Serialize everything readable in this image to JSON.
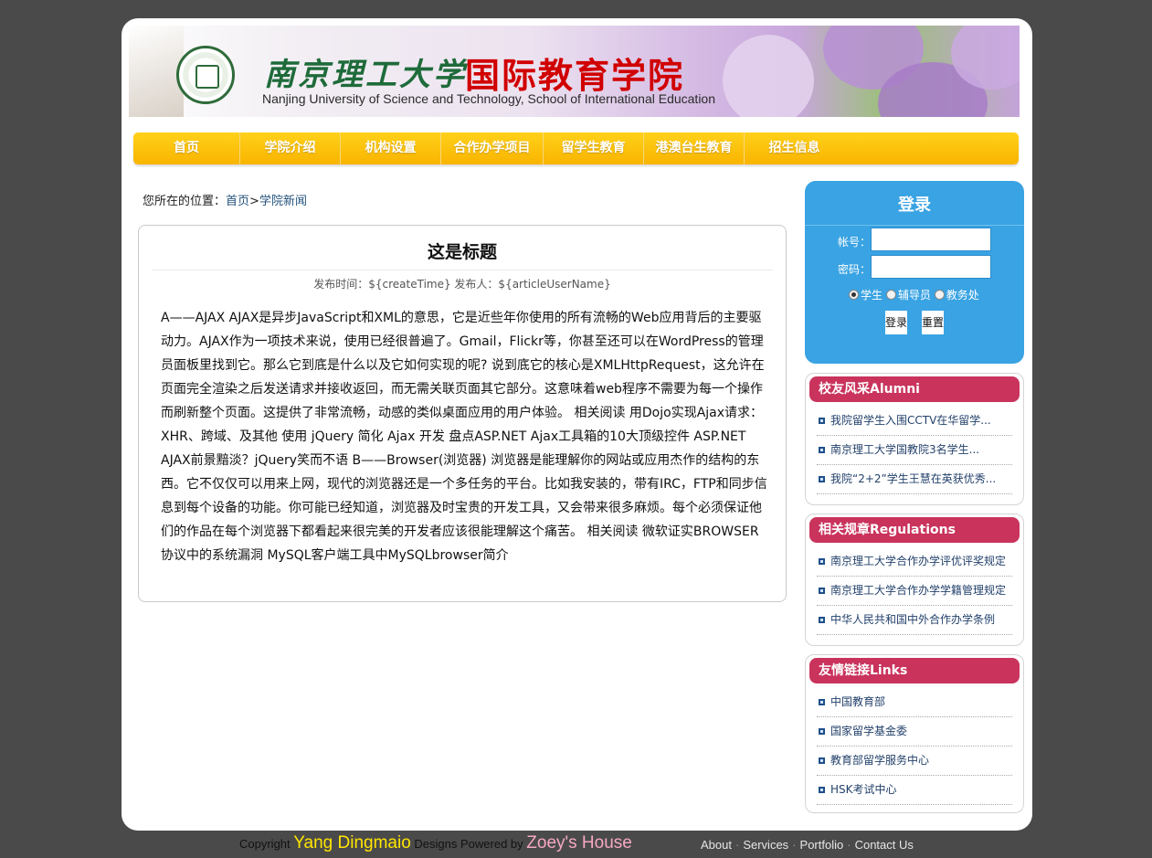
{
  "banner": {
    "school_cn": "南京理工大学",
    "college_cn": "国际教育学院",
    "subtitle_en": "Nanjing University of Science and Technology, School of International Education"
  },
  "nav": {
    "items": [
      "首页",
      "学院介绍",
      "机构设置",
      "合作办学项目",
      "留学生教育",
      "港澳台生教育",
      "招生信息"
    ]
  },
  "breadcrumb": {
    "prefix": "您所在的位置：",
    "home": "首页",
    "sep": ">",
    "current": "学院新闻"
  },
  "article": {
    "title": "这是标题",
    "meta": "发布时间：${createTime}  发布人：${articleUserName}",
    "body": "A——AJAX AJAX是异步JavaScript和XML的意思，它是近些年你使用的所有流畅的Web应用背后的主要驱动力。AJAX作为一项技术来说，使用已经很普遍了。Gmail，Flickr等，你甚至还可以在WordPress的管理员面板里找到它。那么它到底是什么以及它如何实现的呢? 说到底它的核心是XMLHttpRequest，这允许在页面完全渲染之后发送请求并接收返回，而无需关联页面其它部分。这意味着web程序不需要为每一个操作而刷新整个页面。这提供了非常流畅，动感的类似桌面应用的用户体验。 相关阅读 用Dojo实现Ajax请求：XHR、跨域、及其他 使用 jQuery 简化 Ajax 开发 盘点ASP.NET Ajax工具箱的10大顶级控件 ASP.NET AJAX前景黯淡？jQuery笑而不语 B——Browser(浏览器) 浏览器是能理解你的网站或应用杰作的结构的东西。它不仅仅可以用来上网，现代的浏览器还是一个多任务的平台。比如我安装的，带有IRC，FTP和同步信息到每个设备的功能。你可能已经知道，浏览器及时宝贵的开发工具，又会带来很多麻烦。每个必须保证他们的作品在每个浏览器下都看起来很完美的开发者应该很能理解这个痛苦。 相关阅读 微软证实BROWSER协议中的系统漏洞 MySQL客户端工具中MySQLbrowser简介"
  },
  "login": {
    "title": "登录",
    "account_label": "帐号：",
    "account_value": "",
    "password_label": "密码：",
    "password_value": "",
    "roles": [
      "学生",
      "辅导员",
      "教务处"
    ],
    "selected_role": "学生",
    "login_button": "登录",
    "reset_button": "重置"
  },
  "alumni": {
    "title": "校友风采Alumni",
    "items": [
      "我院留学生入围CCTV在华留学...",
      "南京理工大学国教院3名学生...",
      "我院“2+2”学生王慧在英获优秀..."
    ]
  },
  "regulations": {
    "title": "相关规章Regulations",
    "items": [
      "南京理工大学合作办学评优评奖规定",
      "南京理工大学合作办学学籍管理规定",
      "中华人民共和国中外合作办学条例"
    ]
  },
  "links": {
    "title": "友情链接Links",
    "items": [
      "中国教育部",
      "国家留学基金委",
      "教育部留学服务中心",
      "HSK考试中心"
    ]
  },
  "footer": {
    "copyright_prefix": "Copyright",
    "author": "Yang Dingmaio",
    "designs_text": "Designs Powered by",
    "powered_by": "Zoey's House",
    "links": [
      "About",
      "Services",
      "Portfolio",
      "Contact Us"
    ]
  },
  "colors": {
    "background": "#4a4a4a",
    "nav_gold": "#f9b400",
    "login_blue": "#39a3e3",
    "sidebox_head": "#c9335c",
    "college_red": "#d10000"
  }
}
